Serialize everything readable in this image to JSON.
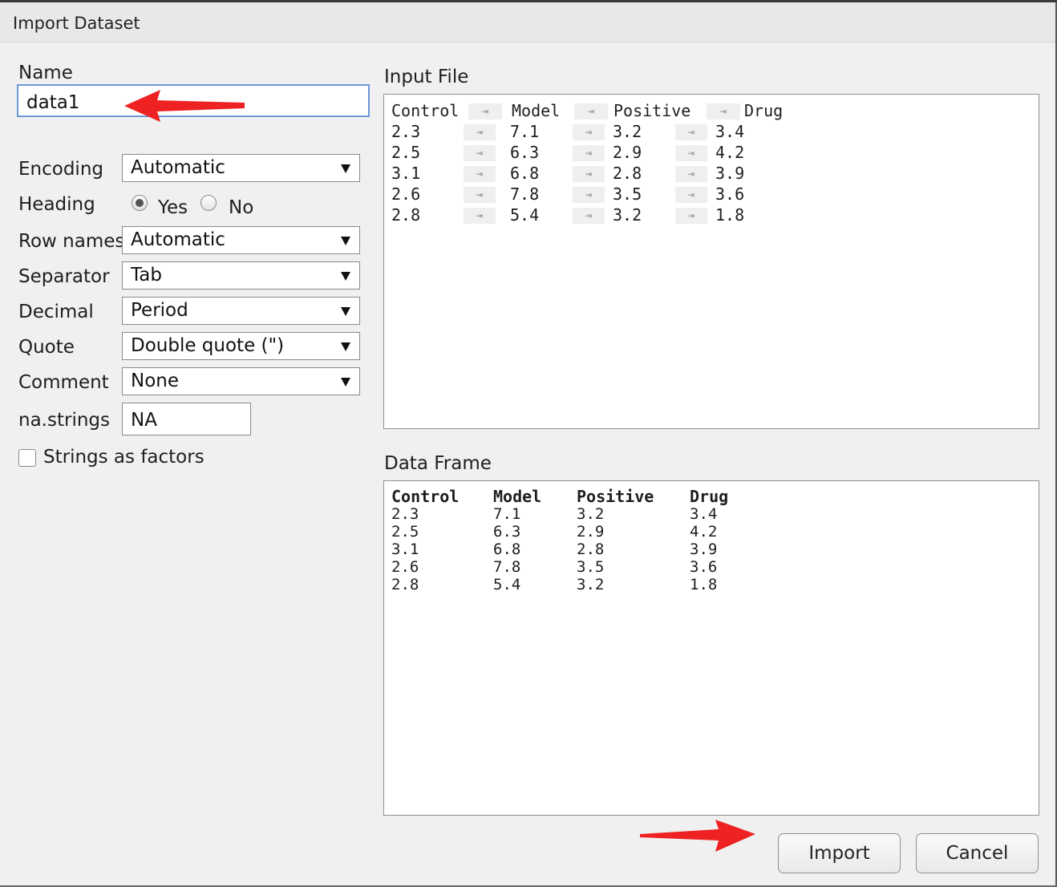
{
  "window": {
    "title": "Import Dataset"
  },
  "name_field": {
    "label": "Name",
    "value": "data1"
  },
  "options": {
    "encoding": {
      "label": "Encoding",
      "value": "Automatic"
    },
    "heading": {
      "label": "Heading",
      "yes_label": "Yes",
      "no_label": "No",
      "selected": "Yes"
    },
    "row_names": {
      "label": "Row names",
      "value": "Automatic"
    },
    "separator": {
      "label": "Separator",
      "value": "Tab"
    },
    "decimal": {
      "label": "Decimal",
      "value": "Period"
    },
    "quote": {
      "label": "Quote",
      "value": "Double quote (\")"
    },
    "comment": {
      "label": "Comment",
      "value": "None"
    },
    "na_strings": {
      "label": "na.strings",
      "value": "NA"
    },
    "strings_as_factors": {
      "label": "Strings as factors",
      "checked": false
    }
  },
  "input_file": {
    "title": "Input File",
    "tab_symbol": "⇥",
    "rows": [
      [
        "Control",
        "Model",
        "Positive",
        "Drug"
      ],
      [
        "2.3",
        "7.1",
        "3.2",
        "3.4"
      ],
      [
        "2.5",
        "6.3",
        "2.9",
        "4.2"
      ],
      [
        "3.1",
        "6.8",
        "2.8",
        "3.9"
      ],
      [
        "2.6",
        "7.8",
        "3.5",
        "3.6"
      ],
      [
        "2.8",
        "5.4",
        "3.2",
        "1.8"
      ]
    ]
  },
  "data_frame": {
    "title": "Data Frame",
    "columns": [
      {
        "header": "Control",
        "values": [
          "2.3",
          "2.5",
          "3.1",
          "2.6",
          "2.8"
        ]
      },
      {
        "header": "Model",
        "values": [
          "7.1",
          "6.3",
          "6.8",
          "7.8",
          "5.4"
        ]
      },
      {
        "header": "Positive",
        "values": [
          "3.2",
          "2.9",
          "2.8",
          "3.5",
          "3.2"
        ]
      },
      {
        "header": "Drug",
        "values": [
          "3.4",
          "4.2",
          "3.9",
          "3.6",
          "1.8"
        ]
      }
    ]
  },
  "buttons": {
    "import_label": "Import",
    "cancel_label": "Cancel"
  },
  "annotations": {
    "arrow_color": "#ee2222"
  }
}
